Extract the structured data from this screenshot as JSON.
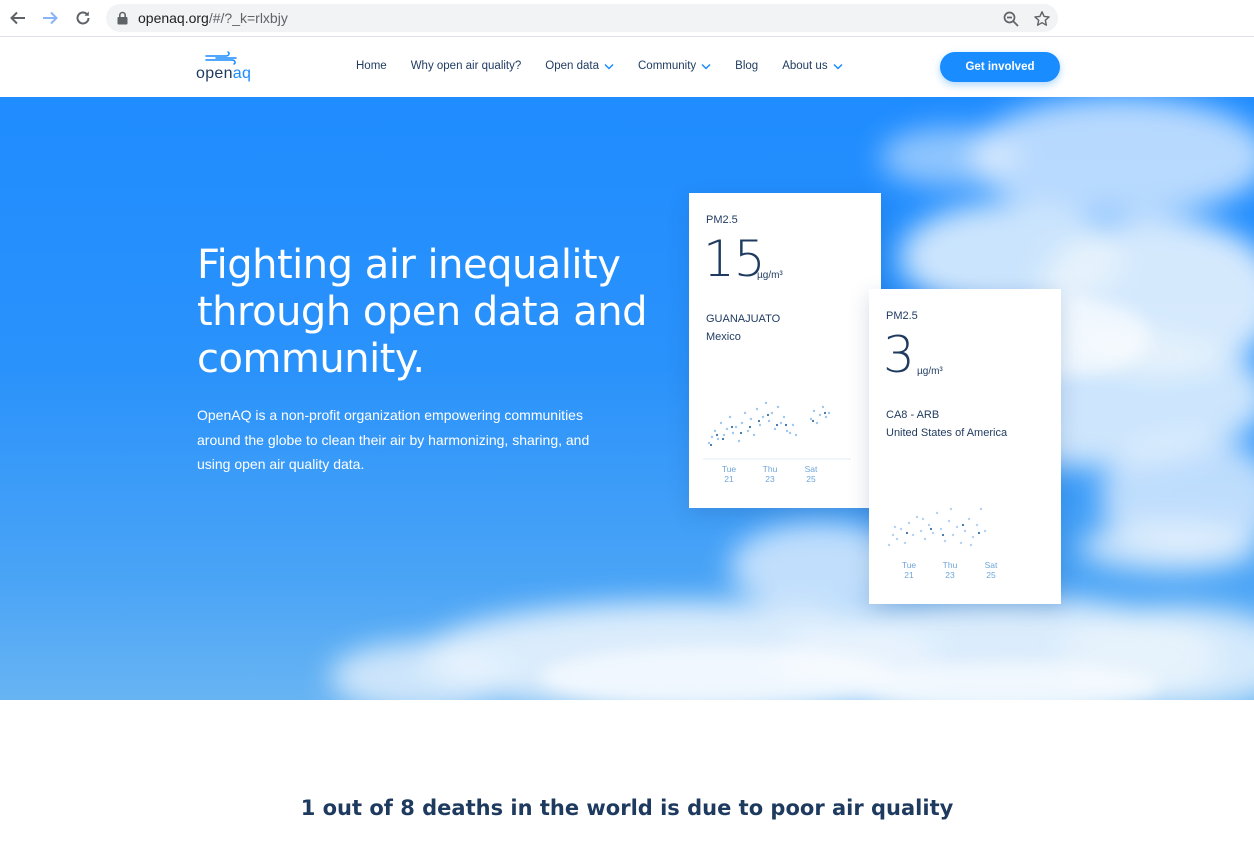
{
  "browser": {
    "url_main": "openaq.org",
    "url_rest": "/#/?_k=rlxbjy",
    "back_icon": "arrow-left-icon",
    "forward_icon": "arrow-right-icon",
    "reload_icon": "reload-icon",
    "zoom_icon": "zoom-icon",
    "star_icon": "star-icon"
  },
  "header": {
    "logo_text_a": "open",
    "logo_text_b": "aq",
    "nav": [
      {
        "label": "Home",
        "dropdown": false
      },
      {
        "label": "Why open air quality?",
        "dropdown": false
      },
      {
        "label": "Open data",
        "dropdown": true
      },
      {
        "label": "Community",
        "dropdown": true
      },
      {
        "label": "Blog",
        "dropdown": false
      },
      {
        "label": "About us",
        "dropdown": true
      }
    ],
    "cta_label": "Get involved"
  },
  "hero": {
    "title": "Fighting air inequality through open data and community.",
    "text": "OpenAQ is a non-profit organization empowering communities around the globe to clean their air by harmonizing, sharing, and using open air quality data."
  },
  "cards": [
    {
      "parameter": "PM2.5",
      "value": "15",
      "unit": "µg/m³",
      "location": "GUANAJUATO",
      "country": "Mexico",
      "days": [
        {
          "day": "Tue",
          "date": "21"
        },
        {
          "day": "Thu",
          "date": "23"
        },
        {
          "day": "Sat",
          "date": "25"
        }
      ]
    },
    {
      "parameter": "PM2.5",
      "value": "3",
      "unit": "µg/m³",
      "location": "CA8 - ARB",
      "country": "United States of America",
      "days": [
        {
          "day": "Tue",
          "date": "21"
        },
        {
          "day": "Thu",
          "date": "23"
        },
        {
          "day": "Sat",
          "date": "25"
        }
      ]
    }
  ],
  "section": {
    "stat": "1 out of 8 deaths in the world is due to poor air quality"
  },
  "colors": {
    "brand_blue": "#198cff",
    "navy": "#1e3a5f"
  }
}
